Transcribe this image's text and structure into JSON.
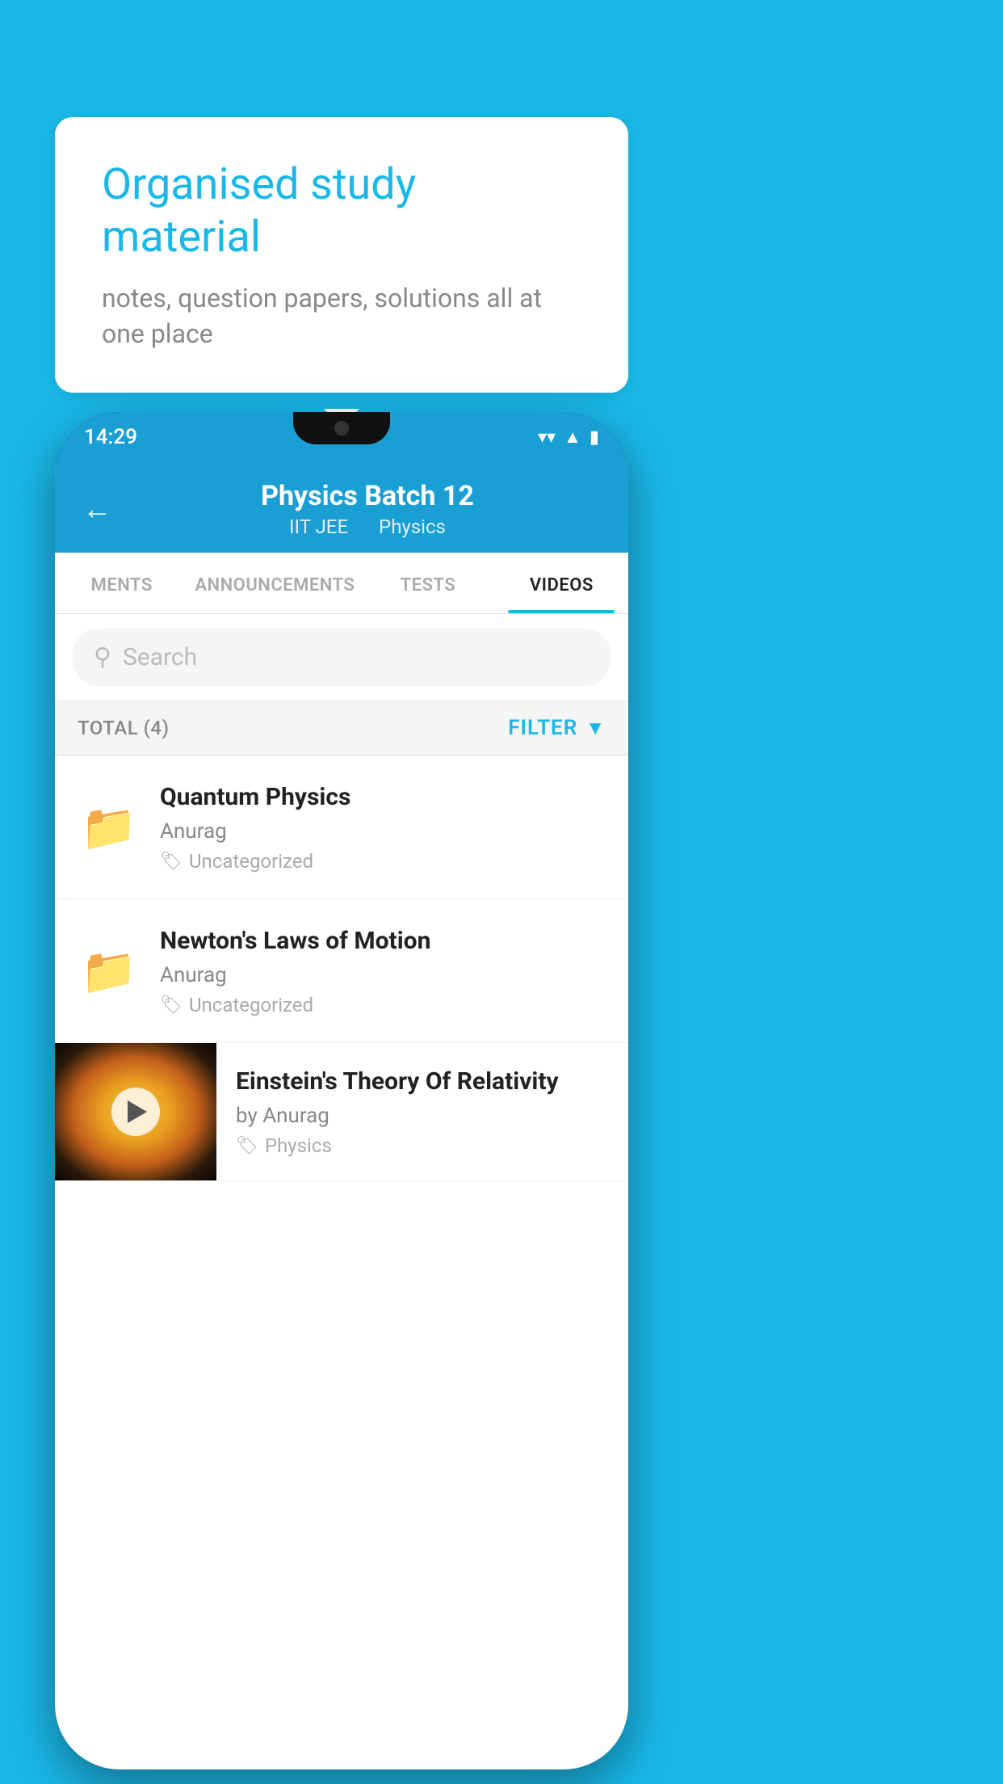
{
  "page": {
    "bg_color": "#1ab8e8"
  },
  "bubble": {
    "title": "Organised study material",
    "subtitle": "notes, question papers, solutions all at one place"
  },
  "status_bar": {
    "time": "14:29",
    "wifi_icon": "wifi-icon",
    "signal_icon": "signal-icon",
    "battery_icon": "battery-icon"
  },
  "header": {
    "back_label": "←",
    "title": "Physics Batch 12",
    "subtitle_part1": "IIT JEE",
    "subtitle_part2": "Physics"
  },
  "tabs": [
    {
      "label": "MENTS",
      "active": false
    },
    {
      "label": "ANNOUNCEMENTS",
      "active": false
    },
    {
      "label": "TESTS",
      "active": false
    },
    {
      "label": "VIDEOS",
      "active": true
    }
  ],
  "search": {
    "placeholder": "Search"
  },
  "filter_row": {
    "total_label": "TOTAL (4)",
    "filter_label": "FILTER"
  },
  "videos": [
    {
      "id": 1,
      "title": "Quantum Physics",
      "author": "Anurag",
      "tag": "Uncategorized",
      "has_thumbnail": false
    },
    {
      "id": 2,
      "title": "Newton's Laws of Motion",
      "author": "Anurag",
      "tag": "Uncategorized",
      "has_thumbnail": false
    },
    {
      "id": 3,
      "title": "Einstein's Theory Of Relativity",
      "author": "by Anurag",
      "tag": "Physics",
      "has_thumbnail": true
    }
  ]
}
